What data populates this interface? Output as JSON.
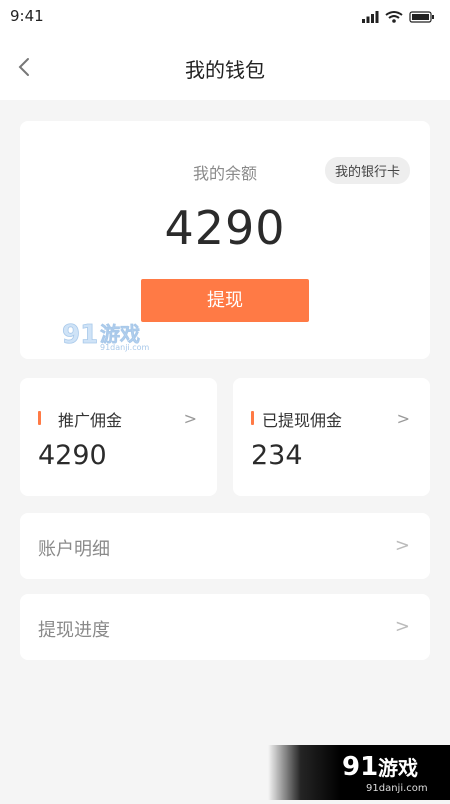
{
  "status_bar": {
    "time": "9:41"
  },
  "nav": {
    "title": "我的钱包"
  },
  "balance": {
    "label": "我的余额",
    "bank_card_label": "我的银行卡",
    "amount": "4290",
    "withdraw_label": "提现"
  },
  "stats": [
    {
      "label": "推广佣金",
      "value": "4290",
      "arrow": ">"
    },
    {
      "label": "已提现佣金",
      "value": "234",
      "arrow": ">"
    }
  ],
  "menu": [
    {
      "label": "账户明细",
      "arrow": ">"
    },
    {
      "label": "提现进度",
      "arrow": ">"
    }
  ],
  "watermark": {
    "brand": "游戏",
    "site": "91danji.com"
  },
  "colors": {
    "accent": "#ff7a45",
    "background": "#f5f5f5",
    "card": "#ffffff"
  }
}
